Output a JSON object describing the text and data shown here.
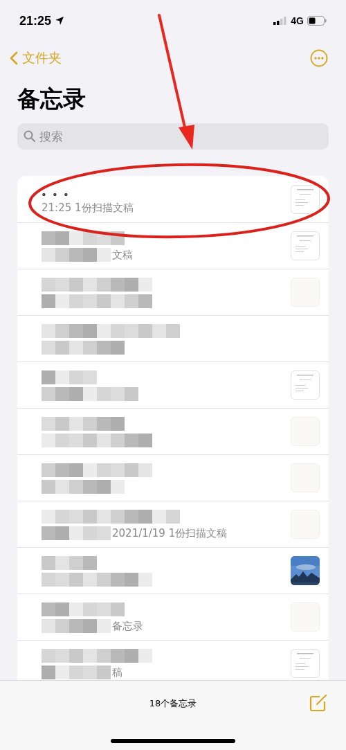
{
  "status_bar": {
    "time": "21:25",
    "network": "4G"
  },
  "nav": {
    "back_label": "文件夹"
  },
  "title": "备忘录",
  "search": {
    "placeholder": "搜索"
  },
  "notes": [
    {
      "title": "。。。",
      "meta": "21:25  1份扫描文稿",
      "thumbnail": {
        "kind": "document"
      },
      "redacted": false
    },
    {
      "meta": "文稿",
      "thumbnail": {
        "kind": "document"
      },
      "redacted": true
    },
    {
      "thumbnail": {
        "kind": "blank"
      },
      "redacted": true
    },
    {
      "redacted": true
    },
    {
      "thumbnail": {
        "kind": "document"
      },
      "redacted": true
    },
    {
      "thumbnail": {
        "kind": "blank"
      },
      "redacted": true
    },
    {
      "thumbnail": {
        "kind": "blank"
      },
      "redacted": true
    },
    {
      "meta": "2021/1/19  1份扫描文稿",
      "thumbnail": {
        "kind": "blank"
      },
      "redacted": true
    },
    {
      "redacted": true
    },
    {
      "meta": "备忘录",
      "thumbnail": {
        "kind": "blank"
      },
      "redacted": true
    },
    {
      "meta": "稿",
      "thumbnail": {
        "kind": "document"
      },
      "redacted": true
    }
  ],
  "toolbar": {
    "count": "18个备忘录"
  }
}
